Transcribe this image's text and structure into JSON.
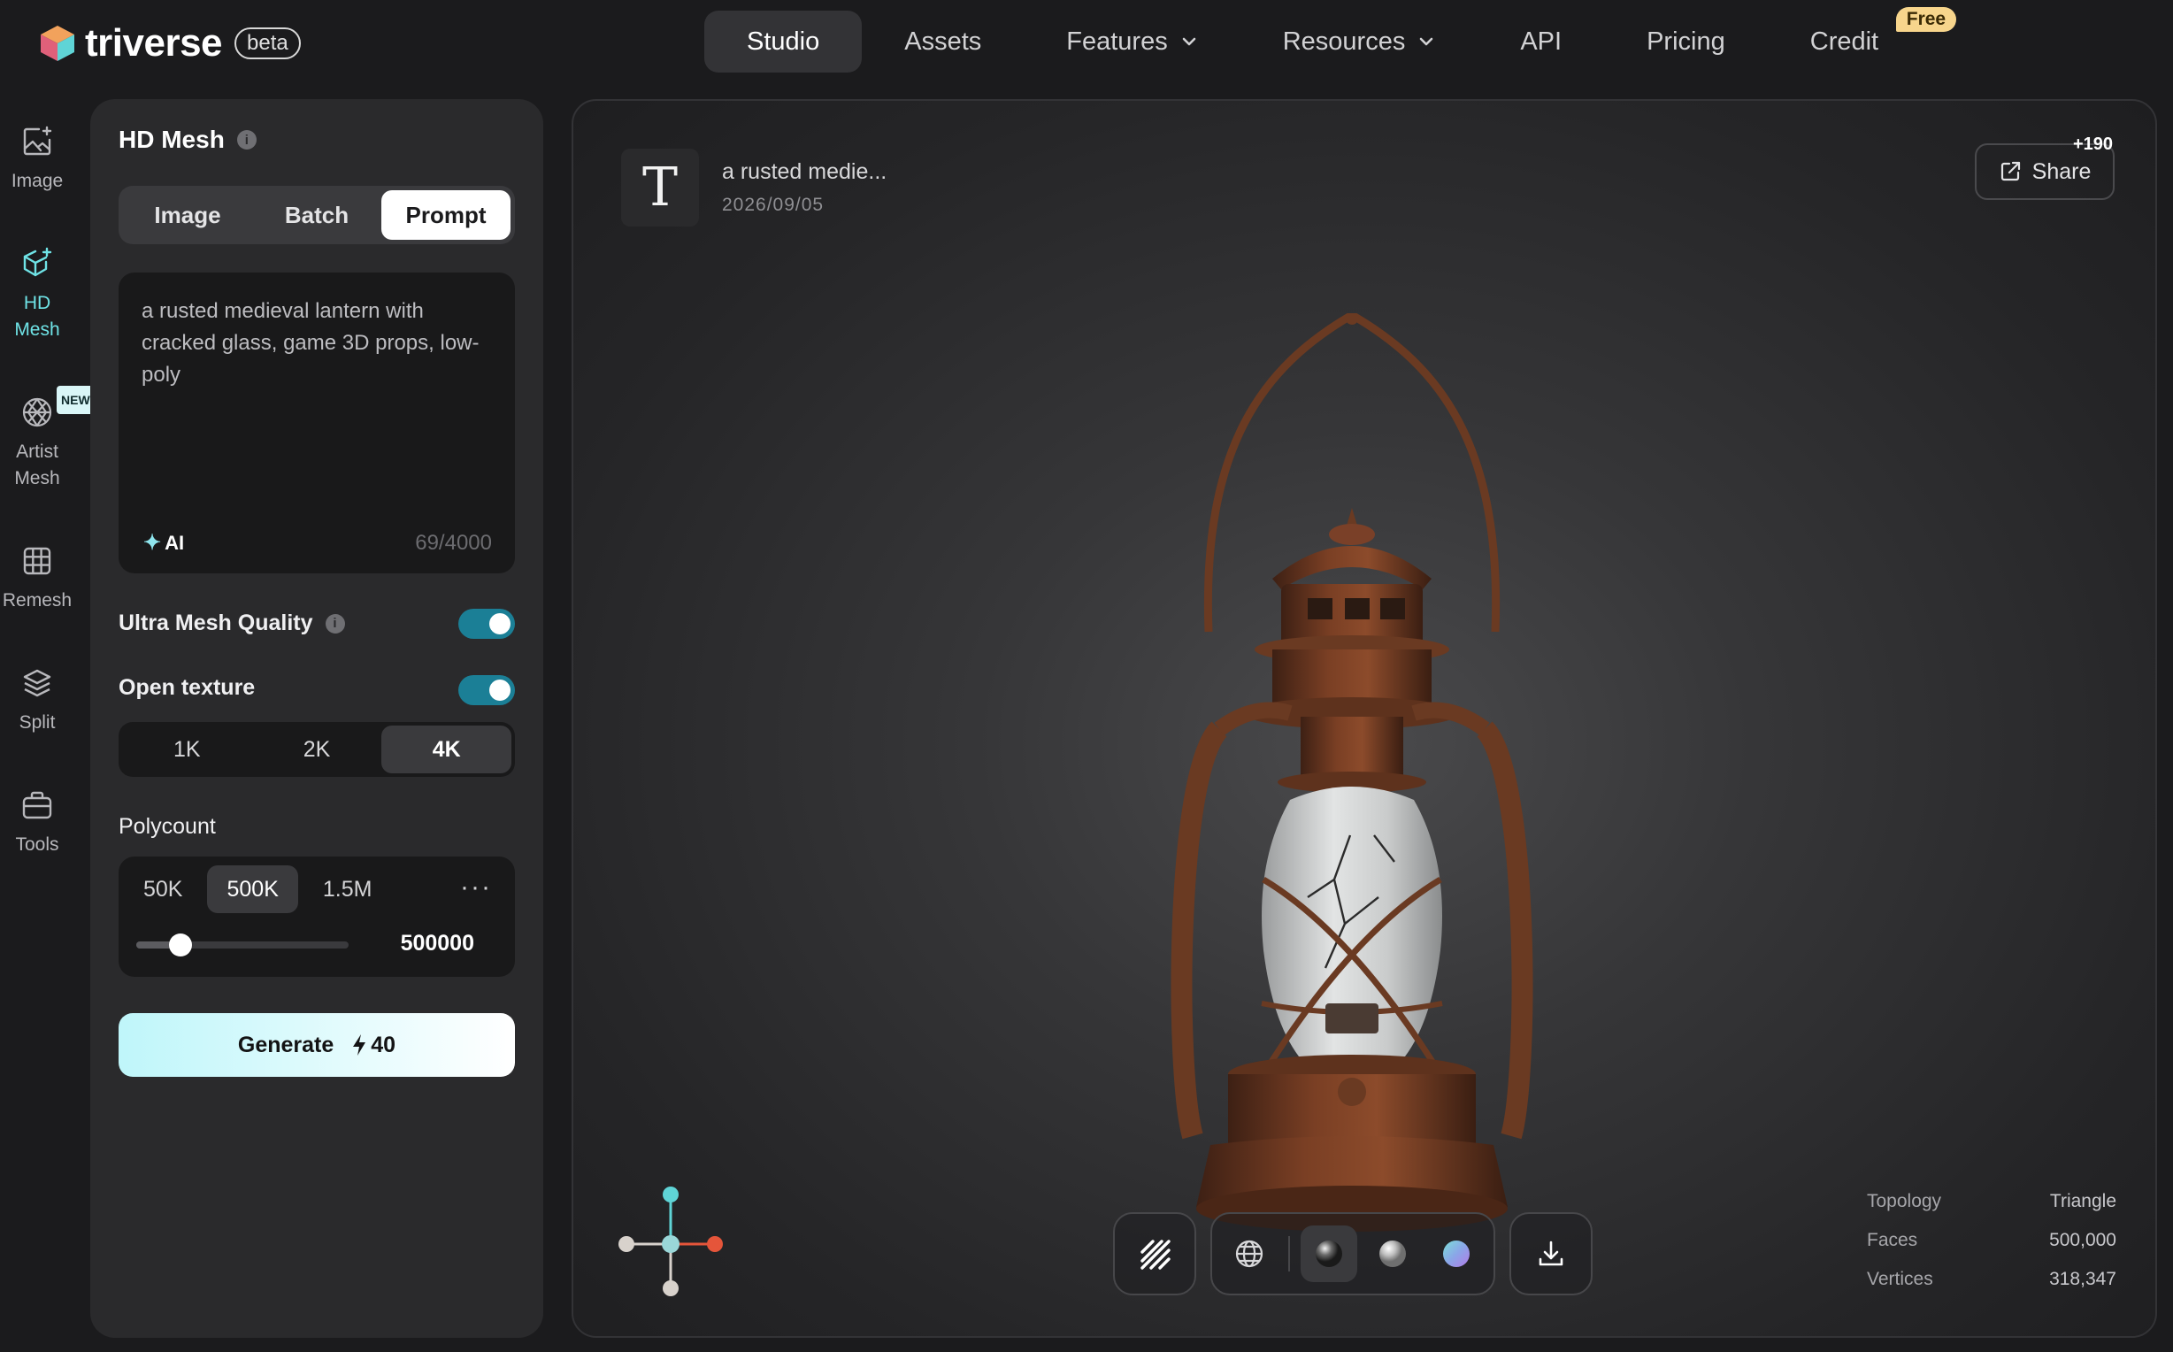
{
  "brand": {
    "name": "triverse",
    "badge": "beta"
  },
  "nav": {
    "items": [
      {
        "label": "Studio"
      },
      {
        "label": "Assets"
      },
      {
        "label": "Features"
      },
      {
        "label": "Resources"
      },
      {
        "label": "API"
      },
      {
        "label": "Pricing"
      },
      {
        "label": "Credit"
      }
    ],
    "credit_badge": "Free"
  },
  "rail": {
    "items": [
      {
        "label": "Image",
        "icon": "image-sparkle-icon"
      },
      {
        "label": "HD Mesh",
        "icon": "cube-sparkle-icon"
      },
      {
        "label": "Artist Mesh",
        "icon": "mesh-sphere-icon",
        "badge": "NEW"
      },
      {
        "label": "Remesh",
        "icon": "grid-icon"
      },
      {
        "label": "Split",
        "icon": "layers-icon"
      },
      {
        "label": "Tools",
        "icon": "toolbox-icon"
      }
    ]
  },
  "panel": {
    "title": "HD Mesh",
    "modes": [
      "Image",
      "Batch",
      "Prompt"
    ],
    "prompt_text": "a rusted medieval lantern with cracked glass, game 3D props, low-poly",
    "ai_label": "AI",
    "char_count": "69/4000",
    "ultra_label": "Ultra Mesh Quality",
    "texture_label": "Open texture",
    "resolutions": [
      "1K",
      "2K",
      "4K"
    ],
    "polycount_label": "Polycount",
    "poly_options": [
      "50K",
      "500K",
      "1.5M"
    ],
    "poly_value": "500000",
    "poly_slider_fraction": 0.21,
    "generate_label": "Generate",
    "generate_cost": "40"
  },
  "viewer": {
    "item_title": "a rusted medie...",
    "item_date": "2026/09/05",
    "share_label": "Share",
    "share_count": "+190",
    "stats": [
      {
        "label": "Topology",
        "value": "Triangle"
      },
      {
        "label": "Faces",
        "value": "500,000"
      },
      {
        "label": "Vertices",
        "value": "318,347"
      }
    ]
  },
  "colors": {
    "accent": "#6fe3e6",
    "toggle_on": "#1b7f96",
    "axis_y": "#5fd4d6",
    "axis_x": "#e5553a",
    "rust": "#7a3f24"
  }
}
